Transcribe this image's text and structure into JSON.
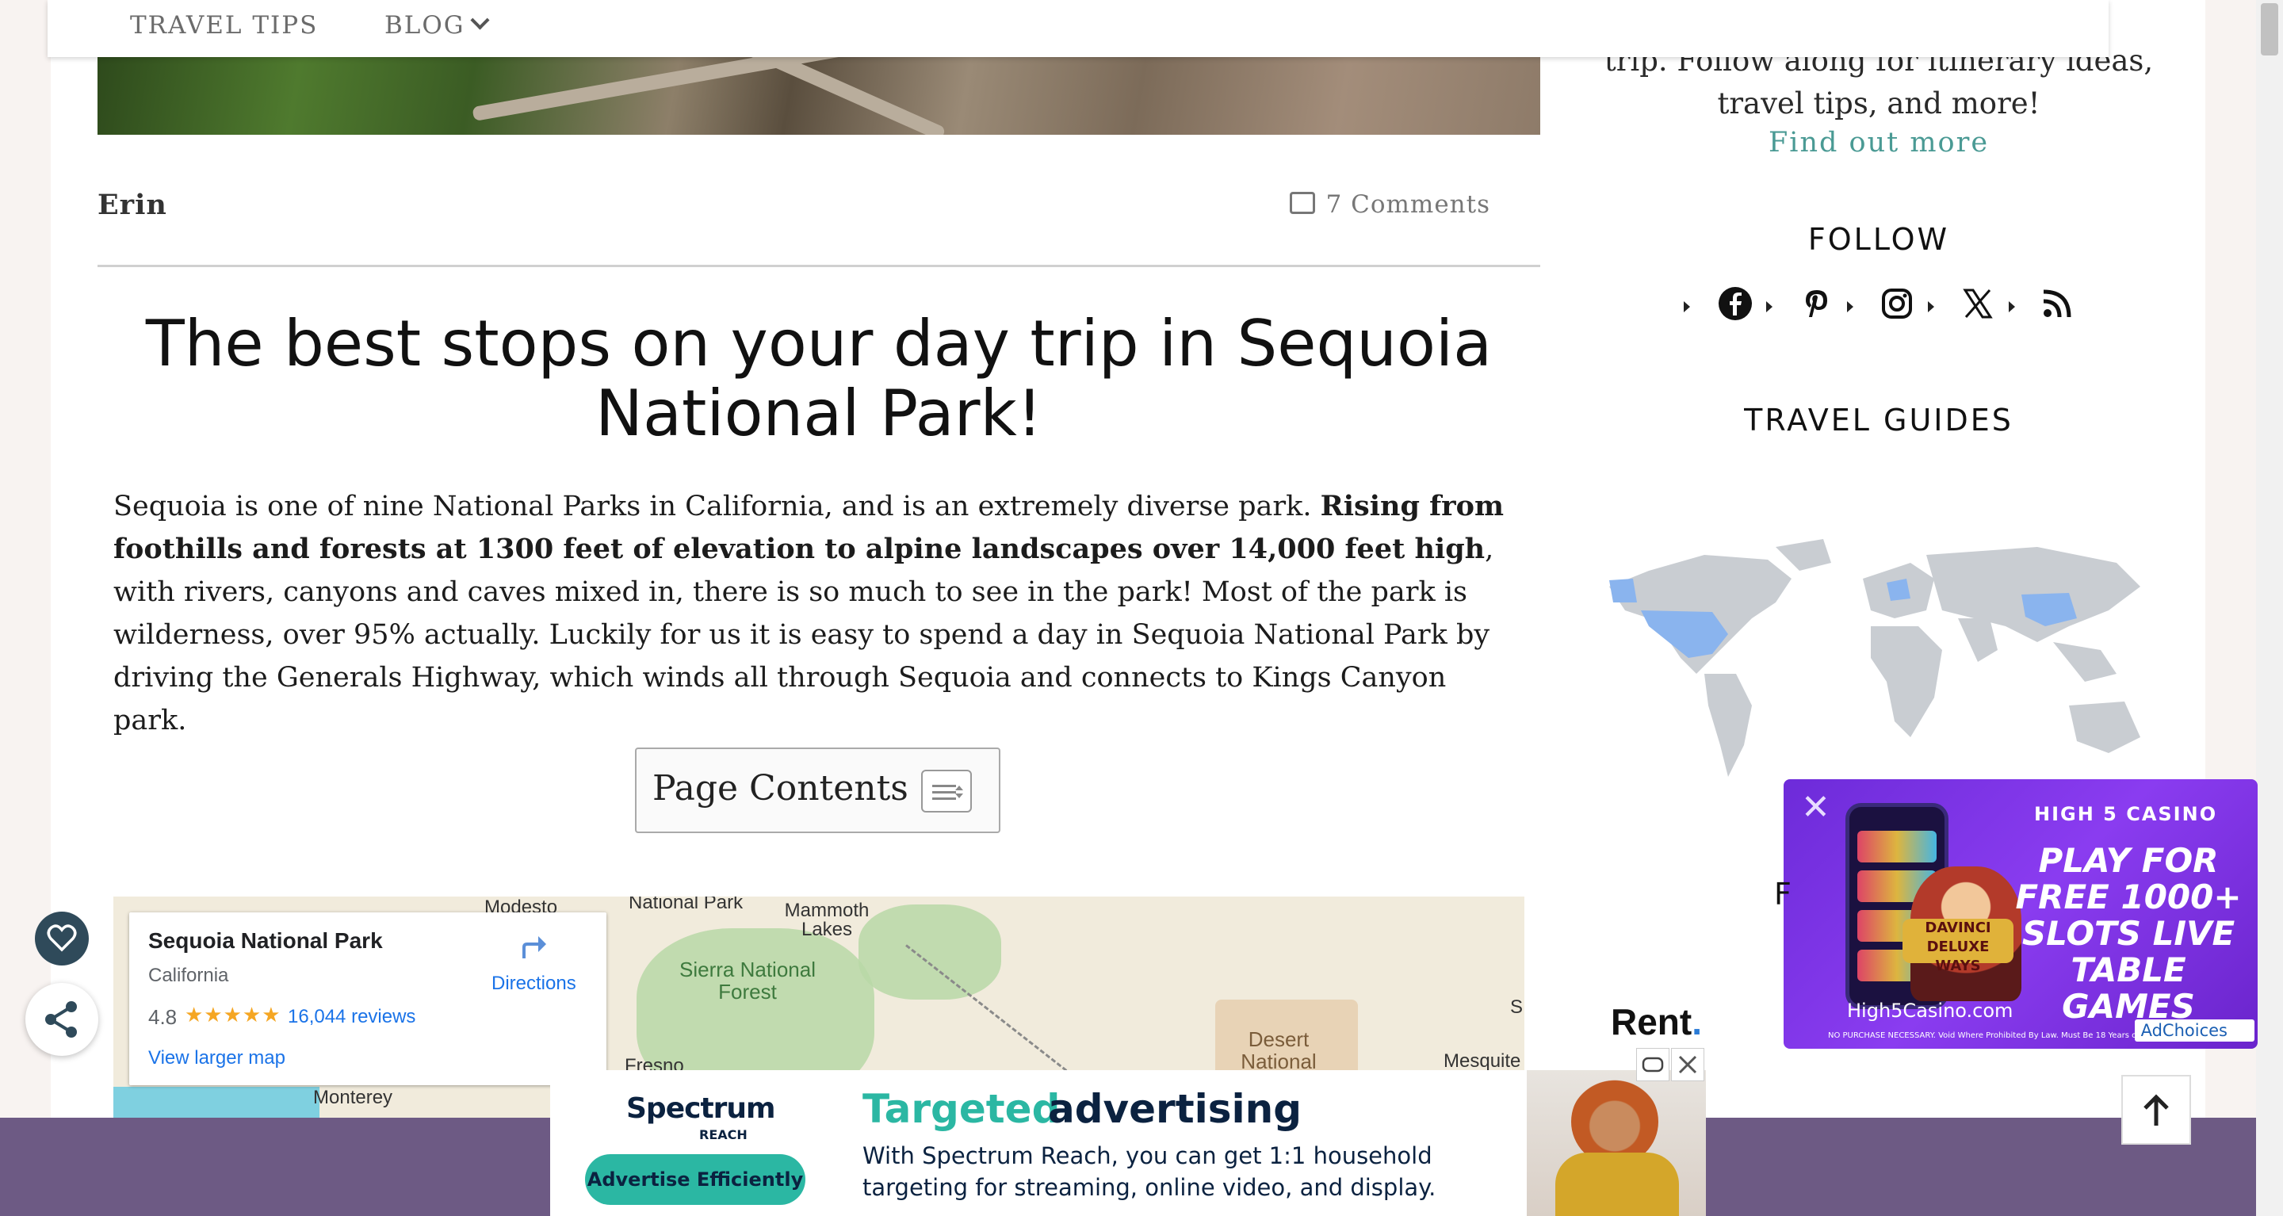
{
  "nav": {
    "items": [
      {
        "label": "TRAVEL TIPS"
      },
      {
        "label": "BLOG"
      }
    ]
  },
  "post": {
    "author": "Erin",
    "comments": "7 Comments",
    "title": "The best stops on your day trip in Sequoia National Park!",
    "intro_1": "Sequoia is one of nine National Parks in California, and is an extremely diverse park. ",
    "intro_bold": "Rising from foothills and forests at 1300 feet of elevation to alpine landscapes over 14,000 feet high",
    "intro_2": ", with rivers, canyons and caves mixed in, there is so much to see in the park! Most of the park is wilderness, over 95% actually. Luckily for us it is easy to spend a day in Sequoia National Park by driving the Generals Highway, which winds all through Sequoia and connects to Kings Canyon park."
  },
  "toc": {
    "title": "Page Contents"
  },
  "map": {
    "place": "Sequoia National Park",
    "region": "California",
    "rating": "4.8",
    "stars": "★★★★★",
    "reviews": "16,044 reviews",
    "larger_map": "View larger map",
    "directions": "Directions",
    "labels": {
      "modesto": "Modesto",
      "national_park": "National Park",
      "mammoth": "Mammoth\nLakes",
      "sierra": "Sierra National\nForest",
      "fresno": "Fresno",
      "monterey": "Monterey",
      "desert": "Desert\nNational",
      "mesquite": "Mesquite",
      "s": "S"
    }
  },
  "sidebar": {
    "about_text": "trip. Follow along for itinerary ideas, travel tips, and more!",
    "find_out_more": "Find out more",
    "follow_heading": "FOLLOW",
    "travel_guides_heading": "TRAVEL GUIDES",
    "partial_letter": "F",
    "social_icons": [
      "facebook-icon",
      "pinterest-icon",
      "instagram-icon",
      "x-icon",
      "rss-icon"
    ]
  },
  "ads": {
    "casino": {
      "brand": "HIGH 5 CASINO",
      "headline": "PLAY FOR FREE 1000+ SLOTS LIVE TABLE GAMES",
      "game": "DAVINCI DELUXE WAYS",
      "url": "High5Casino.com",
      "fine_print": "NO PURCHASE NECESSARY. Void Where Prohibited By Law. Must Be 18 Years or Older. Terms",
      "adchoices": "AdChoices",
      "ad_label": "Ad"
    },
    "banner": {
      "brand": "Spectrum",
      "brand_sub": "REACH",
      "cta": "Advertise Efficiently",
      "headline_a": "Targeted",
      "headline_b": "advertising",
      "body": "With Spectrum Reach, you can get 1:1 household targeting for streaming, online video, and display."
    },
    "rent_logo": "Rent"
  },
  "colors": {
    "accent_link": "#4a9a94",
    "footer": "#6d5a84",
    "casino_purple": "#7b2fe6",
    "spectrum_teal": "#2bb7a3"
  }
}
